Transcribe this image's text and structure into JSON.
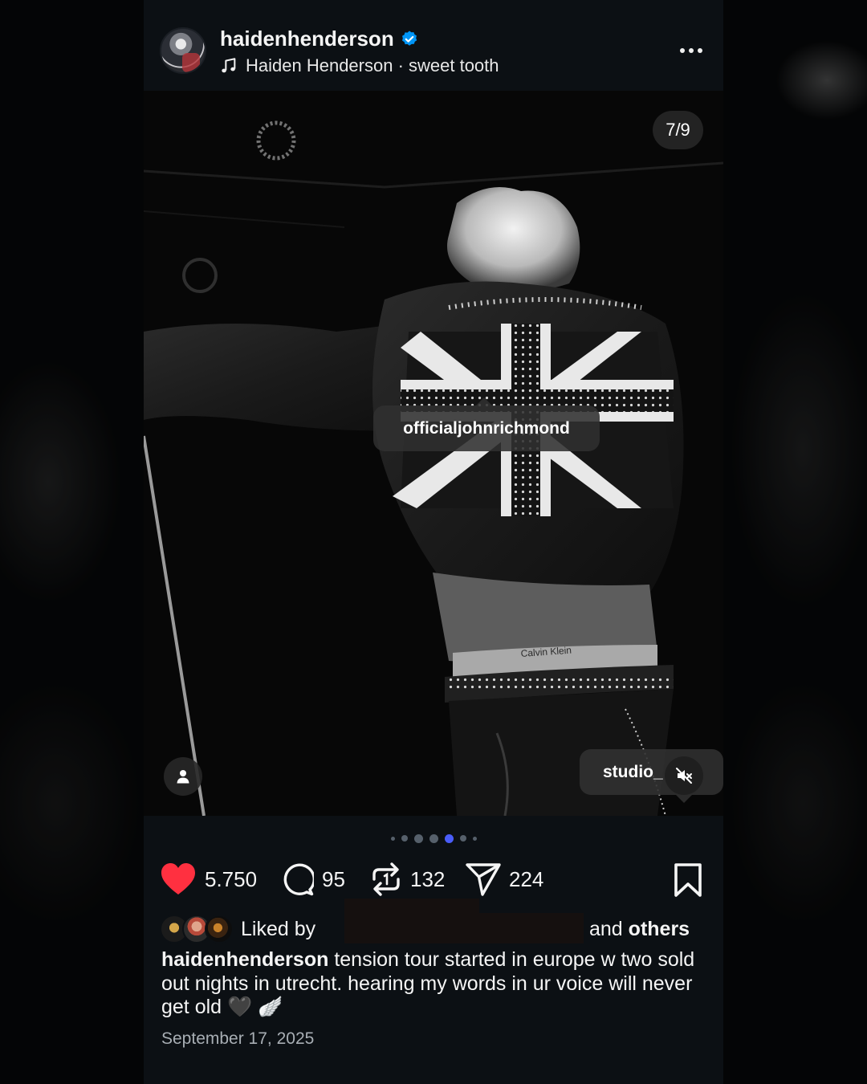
{
  "post": {
    "username": "haidenhenderson",
    "music": "Haiden Henderson · sweet tooth",
    "image_counter": "7/9",
    "tags": [
      "officialjohnrichmond",
      "studio_"
    ],
    "photo_text": "Calvin Klein",
    "carousel": {
      "total_dots_shown": 7,
      "active_dot": 4
    },
    "likes": "5.750",
    "comments": "95",
    "reposts": "132",
    "shares": "224",
    "liked_by_prefix": "Liked by",
    "liked_by_suffix_and": "and",
    "liked_by_suffix_others": "others",
    "caption_user": "haidenhenderson",
    "caption_text": "tension tour started in europe w two sold out nights in utrecht. hearing my words in ur voice will never get old 🖤 🪽",
    "date": "September 17, 2025"
  },
  "colors": {
    "background": "#0c1014",
    "heart": "#ff3040",
    "verified": "#0095f6",
    "active_dot": "#4a5df9",
    "muted_text": "#a8aeb4"
  },
  "icons": {
    "verified": "verified-badge-icon",
    "music": "music-note-icon",
    "more": "more-options-icon",
    "like": "heart-icon",
    "comment": "comment-icon",
    "repost": "repost-icon",
    "share": "share-icon",
    "save": "bookmark-icon",
    "user_tags": "user-tag-icon",
    "mute": "muted-speaker-icon"
  }
}
